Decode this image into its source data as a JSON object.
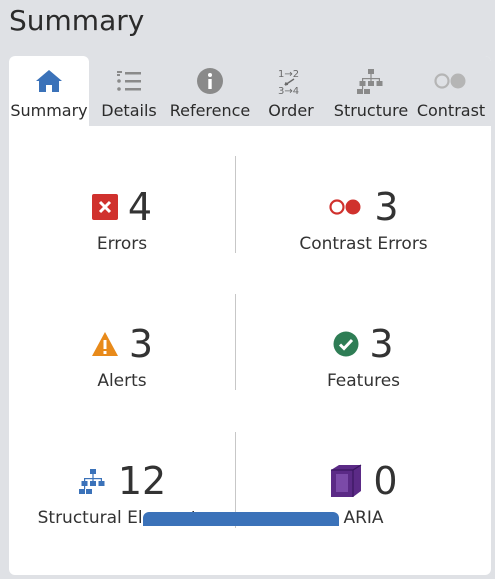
{
  "header": {
    "title": "Summary"
  },
  "tabs": [
    {
      "label": "Summary",
      "icon": "home-icon",
      "active": true
    },
    {
      "label": "Details",
      "icon": "list-icon",
      "active": false
    },
    {
      "label": "Reference",
      "icon": "info-icon",
      "active": false
    },
    {
      "label": "Order",
      "icon": "order-icon",
      "active": false
    },
    {
      "label": "Structure",
      "icon": "structure-icon",
      "active": false
    },
    {
      "label": "Contrast",
      "icon": "contrast-icon",
      "active": false
    }
  ],
  "summary": {
    "errors": {
      "count": "4",
      "label": "Errors",
      "icon": "error-icon",
      "color": "#d0312d"
    },
    "contrast_errors": {
      "count": "3",
      "label": "Contrast Errors",
      "icon": "contrast-error-icon",
      "color": "#d0312d"
    },
    "alerts": {
      "count": "3",
      "label": "Alerts",
      "icon": "alert-icon",
      "color": "#e88a1a"
    },
    "features": {
      "count": "3",
      "label": "Features",
      "icon": "feature-check-icon",
      "color": "#2e7d55"
    },
    "structural": {
      "count": "12",
      "label": "Structural Elements",
      "icon": "structure-icon",
      "color": "#3b72b9"
    },
    "aria": {
      "count": "0",
      "label": "ARIA",
      "icon": "aria-cube-icon",
      "color": "#5b2a86"
    }
  },
  "colors": {
    "accent": "#3b72b9",
    "tab_icon_gray": "#8a8a8a",
    "background": "#dfe1e5"
  }
}
